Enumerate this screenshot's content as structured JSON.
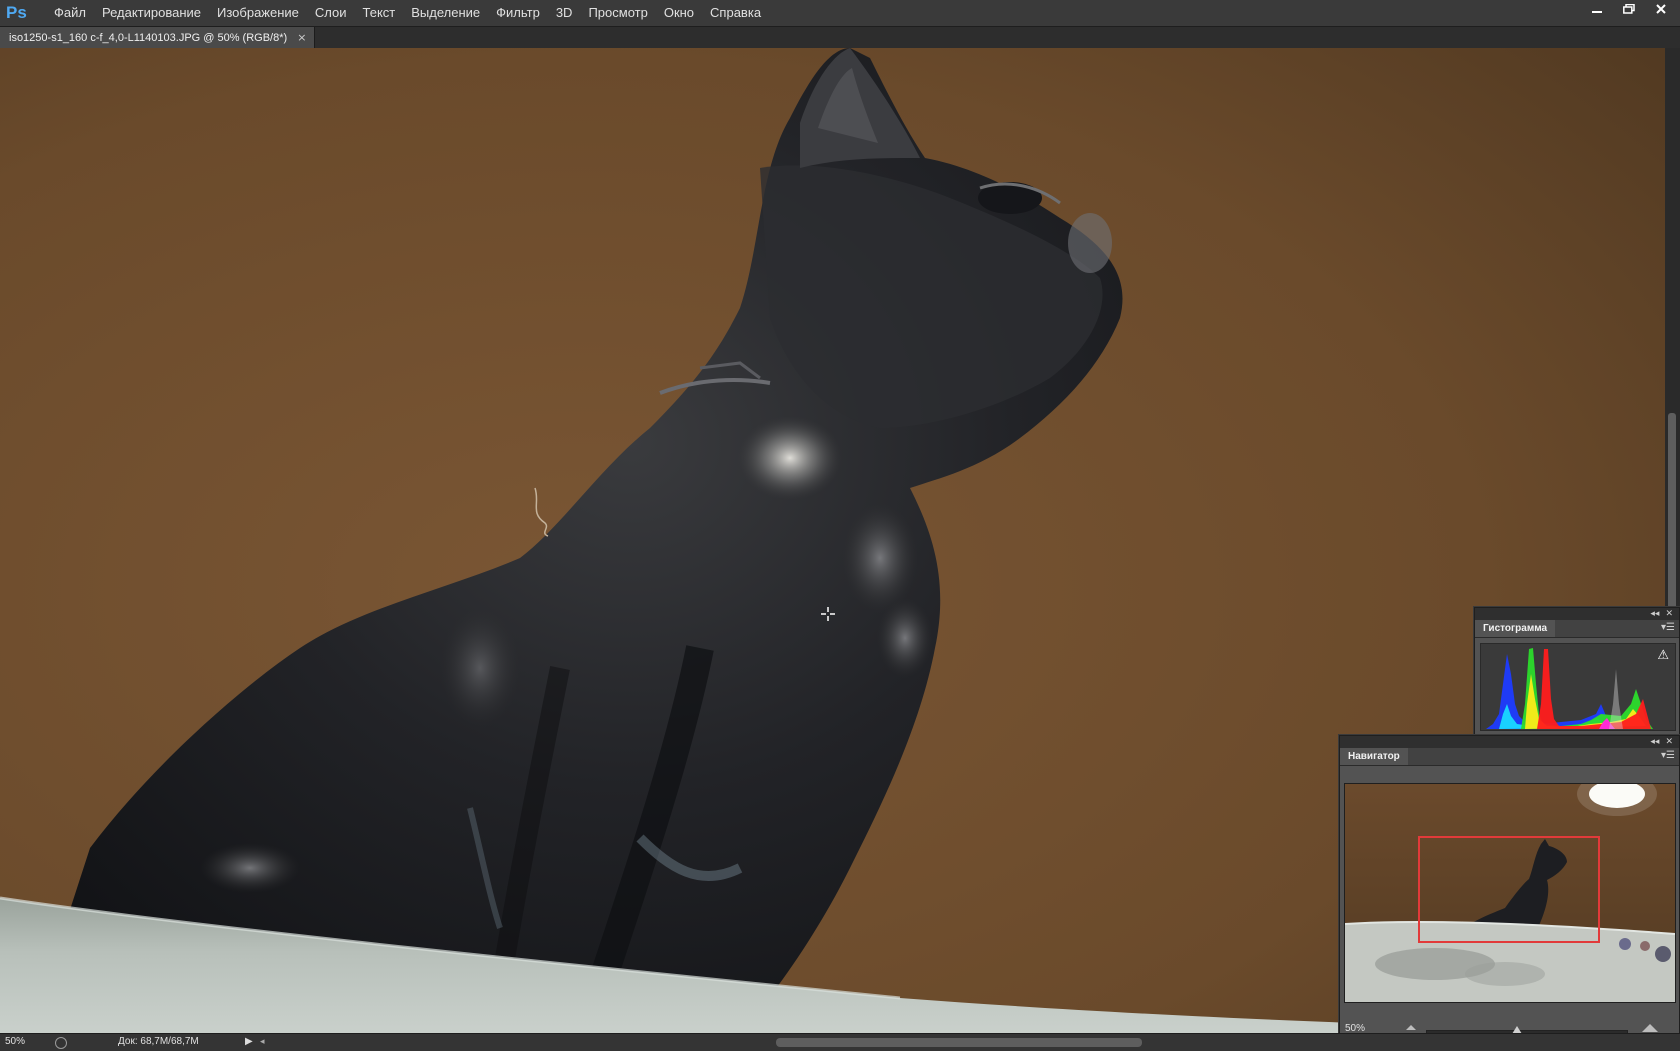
{
  "app": {
    "logo": "Ps"
  },
  "menu": {
    "items": [
      "Файл",
      "Редактирование",
      "Изображение",
      "Слои",
      "Текст",
      "Выделение",
      "Фильтр",
      "3D",
      "Просмотр",
      "Окно",
      "Справка"
    ]
  },
  "window_controls": {
    "minimize_icon": "minimize-icon",
    "restore_icon": "restore-icon",
    "close_icon": "close-icon"
  },
  "document_tab": {
    "title": "iso1250-s1_160 c-f_4,0-L1140103.JPG @ 50% (RGB/8*)",
    "close_glyph": "×"
  },
  "panels": {
    "histogram": {
      "title": "Гистограмма",
      "warning_glyph": "⚠",
      "collapse_glyph": "◂◂",
      "close_glyph": "✕",
      "menu_glyph": "▾☰"
    },
    "navigator": {
      "title": "Навигатор",
      "zoom": "50%",
      "view_box_color": "#e23a3a",
      "collapse_glyph": "◂◂",
      "close_glyph": "✕",
      "menu_glyph": "▾☰"
    }
  },
  "status_bar": {
    "zoom": "50%",
    "doc_size": "Док: 68,7M/68,7M",
    "play_glyph": "▶",
    "left_glyph": "◂"
  },
  "colors": {
    "accent_logo": "#4fa9f2",
    "canvas_background": "#6a4d2d"
  }
}
